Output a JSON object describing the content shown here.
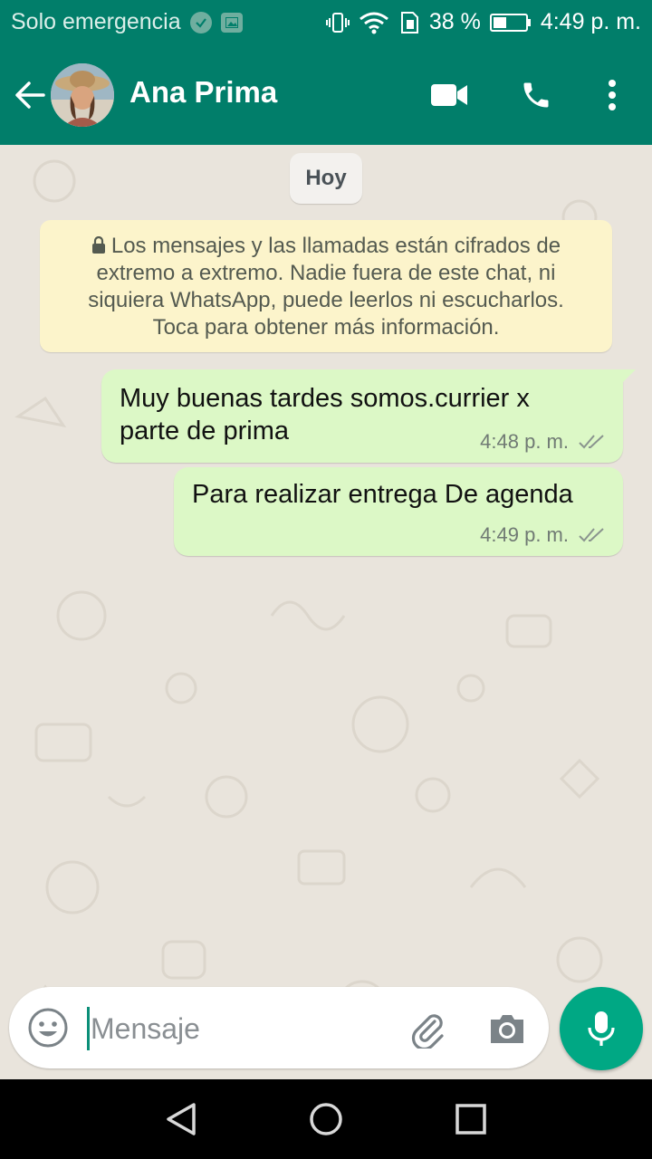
{
  "status_bar": {
    "carrier": "Solo emergencia",
    "battery": "38 %",
    "time": "4:49 p. m."
  },
  "header": {
    "contact_name": "Ana Prima"
  },
  "chat": {
    "date_chip": "Hoy",
    "encryption_notice": "Los mensajes y las llamadas están cifrados de extremo a extremo. Nadie fuera de este chat, ni siquiera WhatsApp, puede leerlos ni escucharlos. Toca para obtener más información.",
    "messages": [
      {
        "line1": "Muy buenas tardes somos.currier x",
        "line2": "parte de prima",
        "time": "4:48 p. m.",
        "status": "delivered"
      },
      {
        "line1": "Para realizar entrega De agenda",
        "time": "4:49 p. m.",
        "status": "delivered"
      }
    ]
  },
  "composer": {
    "placeholder": "Mensaje"
  },
  "colors": {
    "brand": "#017e6a",
    "accent": "#00a884",
    "outgoing_bubble": "#dcf8c6",
    "notice_bg": "#fcf4cb",
    "chat_bg": "#e9e4dc"
  },
  "icons": [
    "back-arrow-icon",
    "video-call-icon",
    "phone-icon",
    "more-options-icon",
    "lock-icon",
    "double-check-icon",
    "emoji-icon",
    "attach-icon",
    "camera-icon",
    "mic-icon",
    "nav-back-icon",
    "nav-home-icon",
    "nav-recents-icon"
  ]
}
